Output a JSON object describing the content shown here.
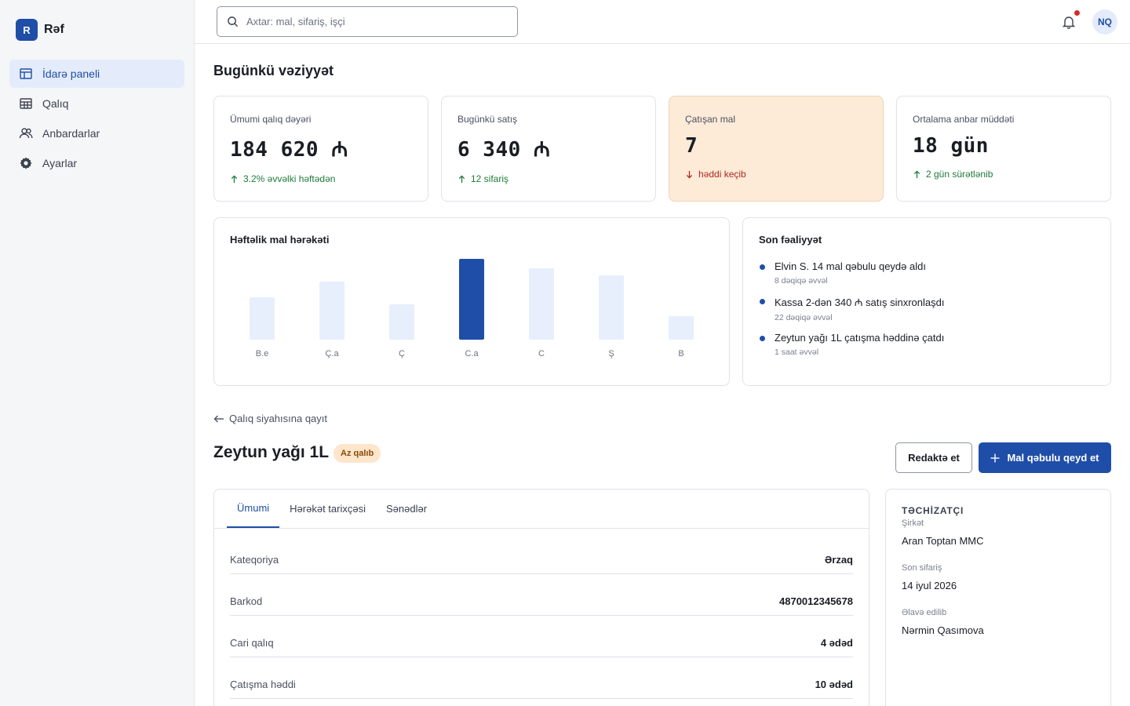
{
  "brand": {
    "logo": "R",
    "name": "Rəf"
  },
  "sidebar": {
    "items": [
      {
        "label": "İdarə paneli",
        "icon": "dashboard-icon",
        "active": true
      },
      {
        "label": "Qalıq",
        "icon": "table-icon",
        "active": false
      },
      {
        "label": "Anbardarlar",
        "icon": "users-icon",
        "active": false
      },
      {
        "label": "Ayarlar",
        "icon": "gear-icon",
        "active": false
      }
    ]
  },
  "topbar": {
    "search_placeholder": "Axtar: mal, sifariş, işçi",
    "notification_dot": true,
    "avatar_initials": "NQ"
  },
  "page": {
    "title": "Bugünkü vəziyyət"
  },
  "kpis": [
    {
      "label": "Ümumi qalıq dəyəri",
      "value": "184 620 ₼",
      "delta": "3.2% əvvəlki həftədən",
      "direction": "up",
      "tone": "normal"
    },
    {
      "label": "Bugünkü satış",
      "value": "6 340 ₼",
      "delta": "12 sifariş",
      "direction": "up",
      "tone": "normal"
    },
    {
      "label": "Çatışan mal",
      "value": "7",
      "delta": "həddi keçib",
      "direction": "down",
      "tone": "warning"
    },
    {
      "label": "Ortalama anbar müddəti",
      "value": "18 gün",
      "delta": "2 gün sürətlənib",
      "direction": "up",
      "tone": "normal"
    }
  ],
  "chart_panel": {
    "title": "Həftəlik mal hərəkəti"
  },
  "chart_data": {
    "type": "bar",
    "title": "Həftəlik mal hərəkəti",
    "categories": [
      "B.e",
      "Ç.a",
      "Ç",
      "C.a",
      "C",
      "Ş",
      "B"
    ],
    "values": [
      54,
      74,
      45,
      103,
      91,
      82,
      30
    ],
    "highlight_index": 3,
    "xlabel": "",
    "ylabel": "",
    "ylim": [
      0,
      103
    ],
    "grid": false,
    "legend": "none",
    "colors": {
      "bar": "#e7effd",
      "highlight": "#1f4ea8"
    }
  },
  "activity": {
    "title": "Son fəaliyyət",
    "items": [
      {
        "text": "Elvin S. 14 mal qəbulu qeydə aldı",
        "time": "8 dəqiqə əvvəl"
      },
      {
        "text": "Kassa 2-dən 340 ₼ satış sinxronlaşdı",
        "time": "22 dəqiqə əvvəl"
      },
      {
        "text": "Zeytun yağı 1L çatışma həddinə çatdı",
        "time": "1 saat əvvəl"
      }
    ]
  },
  "product": {
    "back_label": "Qalıq siyahısına qayıt",
    "title": "Zeytun yağı 1L",
    "badge": "Az qalıb",
    "edit_label": "Redaktə et",
    "primary_label": "Mal qəbulu qeyd et",
    "tabs": [
      {
        "label": "Ümumi",
        "active": true
      },
      {
        "label": "Hərəkət tarixçəsi",
        "active": false
      },
      {
        "label": "Sənədlər",
        "active": false
      }
    ],
    "details": [
      {
        "label": "Kateqoriya",
        "value": "Ərzaq"
      },
      {
        "label": "Barkod",
        "value": "4870012345678"
      },
      {
        "label": "Cari qalıq",
        "value": "4 ədəd"
      },
      {
        "label": "Çatışma həddi",
        "value": "10 ədəd"
      }
    ]
  },
  "supplier": {
    "heading": "TƏCHİZATÇI",
    "fields": [
      {
        "label": "Şirkət",
        "value": "Aran Toptan MMC"
      },
      {
        "label": "Son sifariş",
        "value": "14 iyul 2026"
      },
      {
        "label": "Əlavə edilib",
        "value": "Nərmin Qasımova"
      }
    ]
  },
  "colors": {
    "accent": "#1f4ea8",
    "warning_bg": "#fdebd8",
    "positive": "#1e7a3a",
    "negative": "#b3261e",
    "alert_dot": "#d42a2a"
  }
}
